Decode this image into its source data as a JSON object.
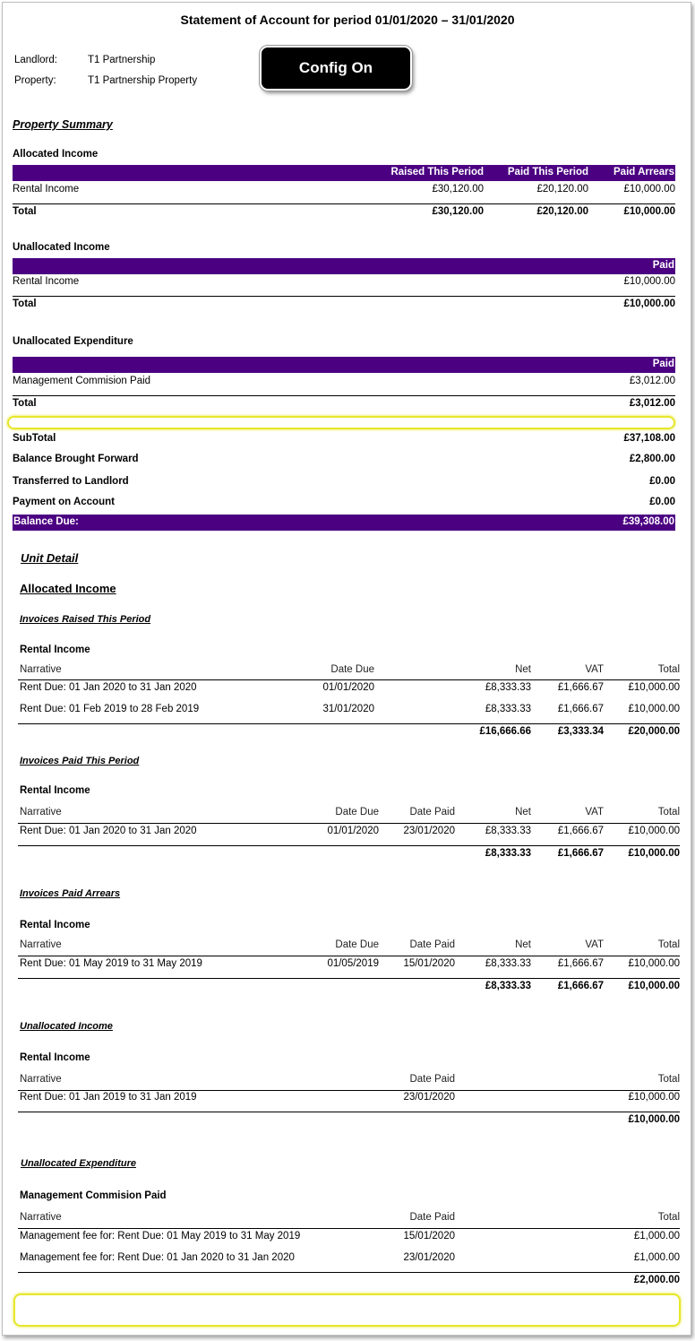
{
  "title": "Statement of Account for period 01/01/2020 – 31/01/2020",
  "landlord_label": "Landlord:",
  "landlord_value": "T1 Partnership",
  "property_label": "Property:",
  "property_value": "T1 Partnership Property",
  "config_button": "Config On",
  "summary": {
    "heading": "Property Summary",
    "allocated": {
      "heading": "Allocated Income",
      "cols": [
        "Raised This Period",
        "Paid This Period",
        "Paid Arrears"
      ],
      "row_label": "Rental Income",
      "row": [
        "£30,120.00",
        "£20,120.00",
        "£10,000.00"
      ],
      "total_label": "Total",
      "total": [
        "£30,120.00",
        "£20,120.00",
        "£10,000.00"
      ]
    },
    "unalloc_income": {
      "heading": "Unallocated Income",
      "col": "Paid",
      "row_label": "Rental Income",
      "row_value": "£10,000.00",
      "total_label": "Total",
      "total_value": "£10,000.00"
    },
    "unalloc_exp": {
      "heading": "Unallocated Expenditure",
      "col": "Paid",
      "row_label": "Management Commision Paid",
      "row_value": "£3,012.00",
      "total_label": "Total",
      "total_value": "£3,012.00"
    },
    "subtotal_label": "SubTotal",
    "subtotal_value": "£37,108.00",
    "bbf_label": "Balance Brought Forward",
    "bbf_value": "£2,800.00",
    "ttl_label": "Transferred to Landlord",
    "ttl_value": "£0.00",
    "poa_label": "Payment on Account",
    "poa_value": "£0.00",
    "due_label": "Balance Due:",
    "due_value": "£39,308.00"
  },
  "unit": {
    "heading": "Unit Detail",
    "alloc_heading": "Allocated Income",
    "raised": {
      "heading": "Invoices Raised This Period",
      "cat": "Rental Income",
      "cols": {
        "narrative": "Narrative",
        "due": "Date Due",
        "net": "Net",
        "vat": "VAT",
        "total": "Total"
      },
      "rows": [
        {
          "narrative": "Rent Due:  01 Jan 2020 to 31 Jan 2020",
          "due": "01/01/2020",
          "net": "£8,333.33",
          "vat": "£1,666.67",
          "total": "£10,000.00"
        },
        {
          "narrative": "Rent Due:  01 Feb 2019 to 28 Feb 2019",
          "due": "31/01/2020",
          "net": "£8,333.33",
          "vat": "£1,666.67",
          "total": "£10,000.00"
        }
      ],
      "totals": {
        "net": "£16,666.66",
        "vat": "£3,333.34",
        "total": "£20,000.00"
      }
    },
    "paid": {
      "heading": "Invoices Paid This Period",
      "cat": "Rental Income",
      "cols": {
        "narrative": "Narrative",
        "due": "Date Due",
        "paid": "Date Paid",
        "net": "Net",
        "vat": "VAT",
        "total": "Total"
      },
      "row": {
        "narrative": "Rent Due:  01 Jan 2020 to 31 Jan 2020",
        "due": "01/01/2020",
        "paid": "23/01/2020",
        "net": "£8,333.33",
        "vat": "£1,666.67",
        "total": "£10,000.00"
      },
      "totals": {
        "net": "£8,333.33",
        "vat": "£1,666.67",
        "total": "£10,000.00"
      }
    },
    "arrears": {
      "heading": "Invoices Paid Arrears",
      "cat": "Rental Income",
      "cols": {
        "narrative": "Narrative",
        "due": "Date Due",
        "paid": "Date Paid",
        "net": "Net",
        "vat": "VAT",
        "total": "Total"
      },
      "row": {
        "narrative": "Rent Due:  01 May 2019 to 31 May 2019",
        "due": "01/05/2019",
        "paid": "15/01/2020",
        "net": "£8,333.33",
        "vat": "£1,666.67",
        "total": "£10,000.00"
      },
      "totals": {
        "net": "£8,333.33",
        "vat": "£1,666.67",
        "total": "£10,000.00"
      }
    },
    "unalloc_income": {
      "heading": "Unallocated Income",
      "cat": "Rental Income",
      "cols": {
        "narrative": "Narrative",
        "paid": "Date Paid",
        "total": "Total"
      },
      "row": {
        "narrative": "Rent Due:  01 Jan 2019 to 31 Jan 2019",
        "paid": "23/01/2020",
        "total": "£10,000.00"
      },
      "total": "£10,000.00"
    },
    "unalloc_exp": {
      "heading": "Unallocated Expenditure",
      "cat": "Management Commision Paid",
      "cols": {
        "narrative": "Narrative",
        "paid": "Date Paid",
        "total": "Total"
      },
      "rows": [
        {
          "narrative": "Management fee for: Rent Due:  01 May 2019 to 31 May 2019",
          "paid": "15/01/2020",
          "total": "£1,000.00"
        },
        {
          "narrative": "Management fee for: Rent Due:  01 Jan 2020 to 31 Jan 2020",
          "paid": "23/01/2020",
          "total": "£1,000.00"
        }
      ],
      "total": "£2,000.00"
    }
  },
  "colors": {
    "accent": "#4b0082",
    "highlight": "#e6e62b"
  }
}
